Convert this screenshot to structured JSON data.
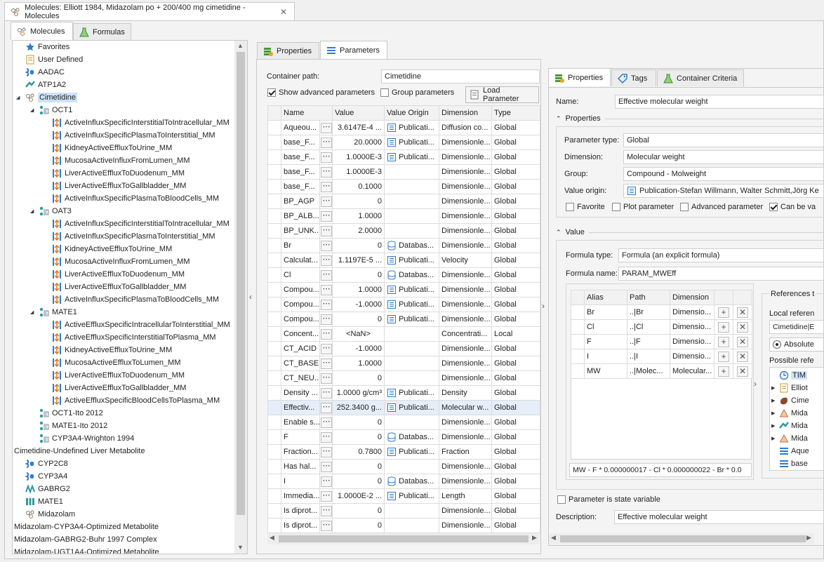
{
  "window": {
    "title": "Molecules: Elliott 1984, Midazolam po + 200/400 mg cimetidine - Molecules"
  },
  "left_tabs": [
    {
      "label": "Molecules"
    },
    {
      "label": "Formulas"
    }
  ],
  "tree": {
    "items": [
      {
        "label": "Favorites"
      },
      {
        "label": "User Defined"
      },
      {
        "label": "AADAC"
      },
      {
        "label": "ATP1A2"
      },
      {
        "label": "Cimetidine"
      },
      {
        "label": "OCT1"
      },
      {
        "label": "ActiveInfluxSpecificInterstitialToIntracellular_MM"
      },
      {
        "label": "ActiveInfluxSpecificPlasmaToInterstitial_MM"
      },
      {
        "label": "KidneyActiveEffluxToUrine_MM"
      },
      {
        "label": "MucosaActiveInfluxFromLumen_MM"
      },
      {
        "label": "LiverActiveEffluxToDuodenum_MM"
      },
      {
        "label": "LiverActiveEffluxToGallbladder_MM"
      },
      {
        "label": "ActiveInfluxSpecificPlasmaToBloodCells_MM"
      },
      {
        "label": "OAT3"
      },
      {
        "label": "ActiveInfluxSpecificInterstitialToIntracellular_MM"
      },
      {
        "label": "ActiveInfluxSpecificPlasmaToInterstitial_MM"
      },
      {
        "label": "KidneyActiveEffluxToUrine_MM"
      },
      {
        "label": "MucosaActiveInfluxFromLumen_MM"
      },
      {
        "label": "LiverActiveEffluxToDuodenum_MM"
      },
      {
        "label": "LiverActiveEffluxToGallbladder_MM"
      },
      {
        "label": "ActiveInfluxSpecificPlasmaToBloodCells_MM"
      },
      {
        "label": "MATE1"
      },
      {
        "label": "ActiveEffluxSpecificIntracellularToInterstitial_MM"
      },
      {
        "label": "ActiveEffluxSpecificInterstitialToPlasma_MM"
      },
      {
        "label": "KidneyActiveEffluxToUrine_MM"
      },
      {
        "label": "MucosaActiveEffluxToLumen_MM"
      },
      {
        "label": "LiverActiveEffluxToDuodenum_MM"
      },
      {
        "label": "LiverActiveEffluxToGallbladder_MM"
      },
      {
        "label": "ActiveEffluxSpecificBloodCellsToPlasma_MM"
      },
      {
        "label": "OCT1-Ito 2012"
      },
      {
        "label": "MATE1-Ito 2012"
      },
      {
        "label": "CYP3A4-Wrighton 1994"
      },
      {
        "label": "Cimetidine-Undefined Liver Metabolite"
      },
      {
        "label": "CYP2C8"
      },
      {
        "label": "CYP3A4"
      },
      {
        "label": "GABRG2"
      },
      {
        "label": "MATE1"
      },
      {
        "label": "Midazolam"
      },
      {
        "label": "Midazolam-CYP3A4-Optimized Metabolite"
      },
      {
        "label": "Midazolam-GABRG2-Buhr 1997 Complex"
      },
      {
        "label": "Midazolam-UGT1A4-Optimized Metabolite"
      }
    ]
  },
  "middle": {
    "tabs": [
      {
        "label": "Properties"
      },
      {
        "label": "Parameters"
      }
    ],
    "container_path_label": "Container path:",
    "container_path_value": "Cimetidine",
    "show_advanced_label": "Show advanced parameters",
    "group_params_label": "Group parameters",
    "load_param_label": "Load Parameter",
    "columns": [
      "Name",
      "Value",
      "Value Origin",
      "Dimension",
      "Type"
    ],
    "rows": [
      {
        "name": "Aqueou...",
        "value": "3.6147E-4 ...",
        "origin": "Publicati...",
        "dim": "Diffusion co...",
        "type": "Global"
      },
      {
        "name": "base_F...",
        "value": "20.0000",
        "origin": "Publicati...",
        "dim": "Dimensionle...",
        "type": "Global"
      },
      {
        "name": "base_F...",
        "value": "1.0000E-3",
        "origin": "Publicati...",
        "dim": "Dimensionle...",
        "type": "Global"
      },
      {
        "name": "base_F...",
        "value": "1.0000E-3",
        "origin": "",
        "dim": "Dimensionle...",
        "type": "Global"
      },
      {
        "name": "base_F...",
        "value": "0.1000",
        "origin": "",
        "dim": "Dimensionle...",
        "type": "Global"
      },
      {
        "name": "BP_AGP",
        "value": "0",
        "origin": "",
        "dim": "Dimensionle...",
        "type": "Global"
      },
      {
        "name": "BP_ALB...",
        "value": "1.0000",
        "origin": "",
        "dim": "Dimensionle...",
        "type": "Global"
      },
      {
        "name": "BP_UNK...",
        "value": "2.0000",
        "origin": "",
        "dim": "Dimensionle...",
        "type": "Global"
      },
      {
        "name": "Br",
        "value": "0",
        "origin": "Databas...",
        "dim": "Dimensionle...",
        "type": "Global"
      },
      {
        "name": "Calculat...",
        "value": "1.1197E-5 ...",
        "origin": "Publicati...",
        "dim": "Velocity",
        "type": "Global"
      },
      {
        "name": "Cl",
        "value": "0",
        "origin": "Databas...",
        "dim": "Dimensionle...",
        "type": "Global"
      },
      {
        "name": "Compou...",
        "value": "1.0000",
        "origin": "Publicati...",
        "dim": "Dimensionle...",
        "type": "Global"
      },
      {
        "name": "Compou...",
        "value": "-1.0000",
        "origin": "Publicati...",
        "dim": "Dimensionle...",
        "type": "Global"
      },
      {
        "name": "Compou...",
        "value": "0",
        "origin": "Publicati...",
        "dim": "Dimensionle...",
        "type": "Global"
      },
      {
        "name": "Concent...",
        "value": "<NaN>",
        "origin": "",
        "dim": "Concentrati...",
        "type": "Local"
      },
      {
        "name": "CT_ACID",
        "value": "-1.0000",
        "origin": "",
        "dim": "Dimensionle...",
        "type": "Global"
      },
      {
        "name": "CT_BASE",
        "value": "1.0000",
        "origin": "",
        "dim": "Dimensionle...",
        "type": "Global"
      },
      {
        "name": "CT_NEU...",
        "value": "0",
        "origin": "",
        "dim": "Dimensionle...",
        "type": "Global"
      },
      {
        "name": "Density ...",
        "value": "1.0000 g/cm³",
        "origin": "Publicati...",
        "dim": "Density",
        "type": "Global"
      },
      {
        "name": "Effectiv...",
        "value": "252.3400 g...",
        "origin": "Publicati...",
        "dim": "Molecular w...",
        "type": "Global"
      },
      {
        "name": "Enable s...",
        "value": "0",
        "origin": "",
        "dim": "Dimensionle...",
        "type": "Global"
      },
      {
        "name": "F",
        "value": "0",
        "origin": "Databas...",
        "dim": "Dimensionle...",
        "type": "Global"
      },
      {
        "name": "Fraction...",
        "value": "0.7800",
        "origin": "Publicati...",
        "dim": "Fraction",
        "type": "Global"
      },
      {
        "name": "Has hal...",
        "value": "0",
        "origin": "",
        "dim": "Dimensionle...",
        "type": "Global"
      },
      {
        "name": "I",
        "value": "0",
        "origin": "Databas...",
        "dim": "Dimensionle...",
        "type": "Global"
      },
      {
        "name": "Immedia...",
        "value": "1.0000E-2 ...",
        "origin": "Publicati...",
        "dim": "Length",
        "type": "Global"
      },
      {
        "name": "Is diprot...",
        "value": "0",
        "origin": "",
        "dim": "Dimensionle...",
        "type": "Global"
      },
      {
        "name": "Is diprot...",
        "value": "0",
        "origin": "",
        "dim": "Dimensionle...",
        "type": "Global"
      }
    ]
  },
  "right": {
    "tabs": [
      {
        "label": "Properties"
      },
      {
        "label": "Tags"
      },
      {
        "label": "Container Criteria"
      }
    ],
    "name_label": "Name:",
    "name_value": "Effective molecular weight",
    "properties_section": "Properties",
    "parameter_type_label": "Parameter type:",
    "parameter_type_value": "Global",
    "dimension_label": "Dimension:",
    "dimension_value": "Molecular weight",
    "group_label": "Group:",
    "group_value": "Compound - Molweight",
    "value_origin_label": "Value origin:",
    "value_origin_value": "Publication-Stefan Willmann, Walter Schmitt,Jörg Ke",
    "checkboxes": [
      {
        "label": "Favorite",
        "checked": false
      },
      {
        "label": "Plot parameter",
        "checked": false
      },
      {
        "label": "Advanced parameter",
        "checked": false
      },
      {
        "label": "Can be va",
        "checked": true
      }
    ],
    "value_section": "Value",
    "formula_type_label": "Formula type:",
    "formula_type_value": "Formula (an explicit formula)",
    "formula_name_label": "Formula name:",
    "formula_name_value": "PARAM_MWEff",
    "alias_columns": [
      "Alias",
      "Path",
      "Dimension"
    ],
    "alias_rows": [
      {
        "alias": "Br",
        "path": "..|Br",
        "dim": "Dimensio..."
      },
      {
        "alias": "Cl",
        "path": "..|Cl",
        "dim": "Dimensio..."
      },
      {
        "alias": "F",
        "path": "..|F",
        "dim": "Dimensio..."
      },
      {
        "alias": "I",
        "path": "..|I",
        "dim": "Dimensio..."
      },
      {
        "alias": "MW",
        "path": "..|Molec...",
        "dim": "Molecular..."
      }
    ],
    "formula_expr": "MW - F * 0.000000017 - Cl * 0.000000022 - Br * 0.0",
    "references_label": "References t",
    "local_ref_label": "Local referen",
    "local_ref_value": "Cimetidine|E",
    "absolute_label": "Absolute",
    "possible_ref_label": "Possible refe",
    "ref_items": [
      {
        "label": "TIM"
      },
      {
        "label": "Elliot"
      },
      {
        "label": "Cime"
      },
      {
        "label": "Mida"
      },
      {
        "label": "Mida"
      },
      {
        "label": "Mida"
      },
      {
        "label": "Aque"
      },
      {
        "label": "base"
      }
    ],
    "state_variable_label": "Parameter is state variable",
    "description_label": "Description:",
    "description_value": "Effective molecular weight"
  },
  "colors": {
    "accent": "#2e7bcf",
    "selected_row": "#e5eef9",
    "tree_selected": "#cde2f7"
  }
}
